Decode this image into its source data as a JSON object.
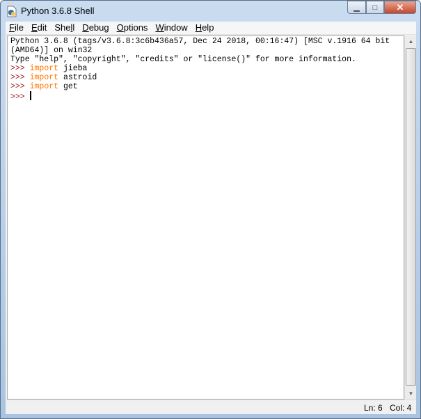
{
  "window": {
    "title": "Python 3.6.8 Shell",
    "icon": "idle-python-icon",
    "controls": [
      "minimize",
      "maximize",
      "close"
    ]
  },
  "menu": [
    {
      "label": "File",
      "accel": "F",
      "rest": "ile"
    },
    {
      "label": "Edit",
      "accel": "E",
      "rest": "dit"
    },
    {
      "label": "Shell",
      "pre": "She",
      "accel": "l",
      "rest": "l"
    },
    {
      "label": "Debug",
      "accel": "D",
      "rest": "ebug"
    },
    {
      "label": "Options",
      "accel": "O",
      "rest": "ptions"
    },
    {
      "label": "Window",
      "accel": "W",
      "rest": "indow"
    },
    {
      "label": "Help",
      "accel": "H",
      "rest": "elp"
    }
  ],
  "shell": {
    "banner": [
      "Python 3.6.8 (tags/v3.6.8:3c6b436a57, Dec 24 2018, 00:16:47) [MSC v.1916 64 bit",
      "(AMD64)] on win32",
      "Type \"help\", \"copyright\", \"credits\" or \"license()\" for more information."
    ],
    "prompt": ">>>",
    "lines": [
      {
        "kw": "import",
        "arg": "jieba"
      },
      {
        "kw": "import",
        "arg": "astroid"
      },
      {
        "kw": "import",
        "arg": "get"
      }
    ],
    "colors": {
      "prompt": "#9a1010",
      "keyword": "#ff7700"
    }
  },
  "status": {
    "ln": "Ln: 6",
    "col": "Col: 4"
  }
}
